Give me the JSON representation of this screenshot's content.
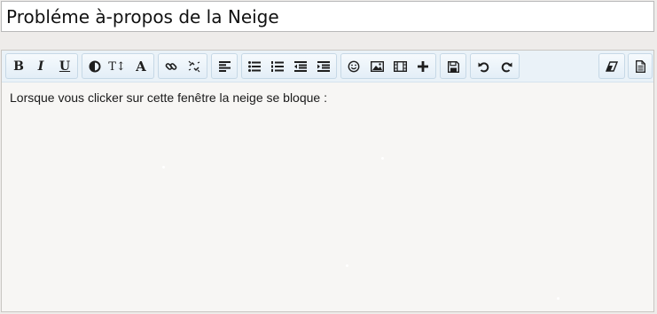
{
  "title_field": {
    "value": "Probléme à-propos de la Neige"
  },
  "toolbar": {
    "bold_label": "B",
    "italic_label": "I",
    "underline_label": "U",
    "fontsize_label": "T↕",
    "font_label": "A",
    "icons": [
      "bold-icon",
      "italic-icon",
      "underline-icon",
      "color-contrast-icon",
      "font-size-icon",
      "font-family-icon",
      "link-icon",
      "unlink-icon",
      "align-left-icon",
      "bullet-list-icon",
      "numbered-list-icon",
      "outdent-icon",
      "indent-icon",
      "smiley-icon",
      "image-icon",
      "video-icon",
      "plus-icon",
      "save-icon",
      "undo-icon",
      "redo-icon",
      "eraser-icon",
      "document-icon"
    ]
  },
  "editor": {
    "text": "Lorsque vous clicker sur cette fenêtre la neige se bloque :"
  },
  "colors": {
    "toolbar_bg": "#eaf2f8",
    "toolbar_border": "#c6d8e6",
    "editor_bg": "#f7f6f4",
    "page_bg": "#eeecea"
  }
}
